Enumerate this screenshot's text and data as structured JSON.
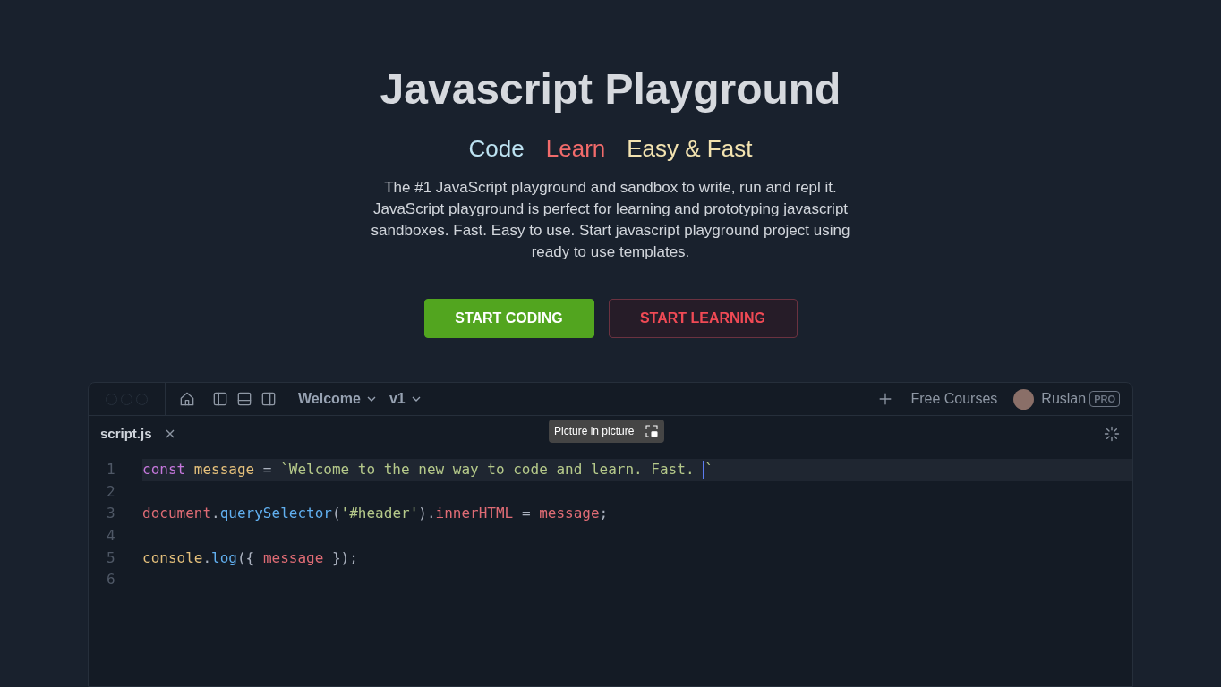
{
  "hero": {
    "title": "Javascript Playground",
    "taglines": [
      {
        "text": "Code",
        "color": "#bde3f2"
      },
      {
        "text": "Learn",
        "color": "#f16b6b"
      },
      {
        "text": "Easy & Fast",
        "color": "#f3e3b0"
      }
    ],
    "description": "The #1 JavaScript playground and sandbox to write, run and repl it. JavaScript playground is perfect for learning and prototyping javascript sandboxes. Fast. Easy to use. Start javascript playground project using ready to use templates.",
    "buttons": [
      {
        "label": "START CODING",
        "kind": "primary"
      },
      {
        "label": "START LEARNING",
        "kind": "secondary"
      }
    ]
  },
  "editor": {
    "toolbar": {
      "project": "Welcome",
      "version": "v1",
      "link": "Free Courses",
      "user": "Ruslan",
      "badge": "PRO"
    },
    "tabs": [
      {
        "label": "script.js",
        "selected": true
      }
    ],
    "lines": [
      {
        "number": "1",
        "active": true,
        "tokens": [
          {
            "text": "const ",
            "kind": "keyword"
          },
          {
            "text": "message",
            "kind": "variable"
          },
          {
            "text": " = ",
            "kind": "plain"
          },
          {
            "text": "`Welcome to the new way to code and learn. Fast. ",
            "kind": "string"
          },
          {
            "text": "`",
            "kind": "string",
            "cursor_before": true
          }
        ]
      },
      {
        "number": "2",
        "active": false
      },
      {
        "number": "3",
        "active": false,
        "tokens": [
          {
            "text": "document",
            "kind": "object"
          },
          {
            "text": ".",
            "kind": "plain"
          },
          {
            "text": "querySelector",
            "kind": "method"
          },
          {
            "text": "(",
            "kind": "plain"
          },
          {
            "text": "'#header'",
            "kind": "string"
          },
          {
            "text": ").",
            "kind": "plain"
          },
          {
            "text": "innerHTML",
            "kind": "object"
          },
          {
            "text": " = ",
            "kind": "plain"
          },
          {
            "text": "message",
            "kind": "object"
          },
          {
            "text": ";",
            "kind": "plain"
          }
        ]
      },
      {
        "number": "4",
        "active": false
      },
      {
        "number": "5",
        "active": false,
        "tokens": [
          {
            "text": "console",
            "kind": "variable"
          },
          {
            "text": ".",
            "kind": "plain"
          },
          {
            "text": "log",
            "kind": "method"
          },
          {
            "text": "({ ",
            "kind": "plain"
          },
          {
            "text": "message",
            "kind": "object"
          },
          {
            "text": " });",
            "kind": "plain"
          }
        ]
      },
      {
        "number": "6",
        "active": false
      }
    ]
  },
  "tooltip": {
    "text": "Picture in picture"
  }
}
